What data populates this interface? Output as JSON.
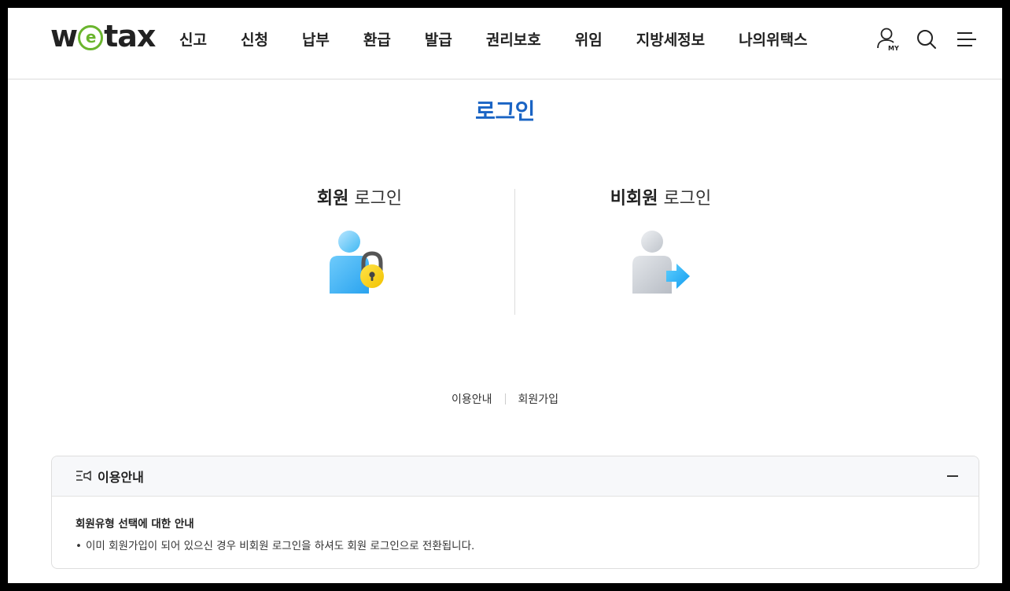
{
  "header": {
    "logo": {
      "pre": "w",
      "mid": "e",
      "post": "tax"
    },
    "nav": [
      {
        "label": "신고"
      },
      {
        "label": "신청"
      },
      {
        "label": "납부"
      },
      {
        "label": "환급"
      },
      {
        "label": "발급"
      },
      {
        "label": "권리보호"
      },
      {
        "label": "위임"
      },
      {
        "label": "지방세정보"
      },
      {
        "label": "나의위택스"
      }
    ],
    "my_label": "MY",
    "icons": [
      "my-user-icon",
      "search-icon",
      "hamburger-menu-icon"
    ]
  },
  "page": {
    "title": "로그인"
  },
  "login": {
    "member": {
      "bold": "회원",
      "rest": " 로그인",
      "icon": "member-lock-icon"
    },
    "guest": {
      "bold": "비회원",
      "rest": " 로그인",
      "icon": "guest-arrow-icon"
    }
  },
  "links": {
    "guide": "이용안내",
    "signup": "회원가입"
  },
  "info": {
    "title": "이용안내",
    "icon": "notice-list-icon",
    "toggle_icon": "collapse-minus-icon",
    "subtitle": "회원유형 선택에 대한 안내",
    "bullet_mark": "•",
    "bullet": "이미 회원가입이 되어 있으신 경우 비회원 로그인을 하셔도 회원 로그인으로 전환됩니다."
  },
  "colors": {
    "title_blue": "#1a64c4",
    "logo_green": "#6ab52e",
    "lock_yellow": "#f7d31a",
    "arrow_blue": "#1faaf2"
  }
}
